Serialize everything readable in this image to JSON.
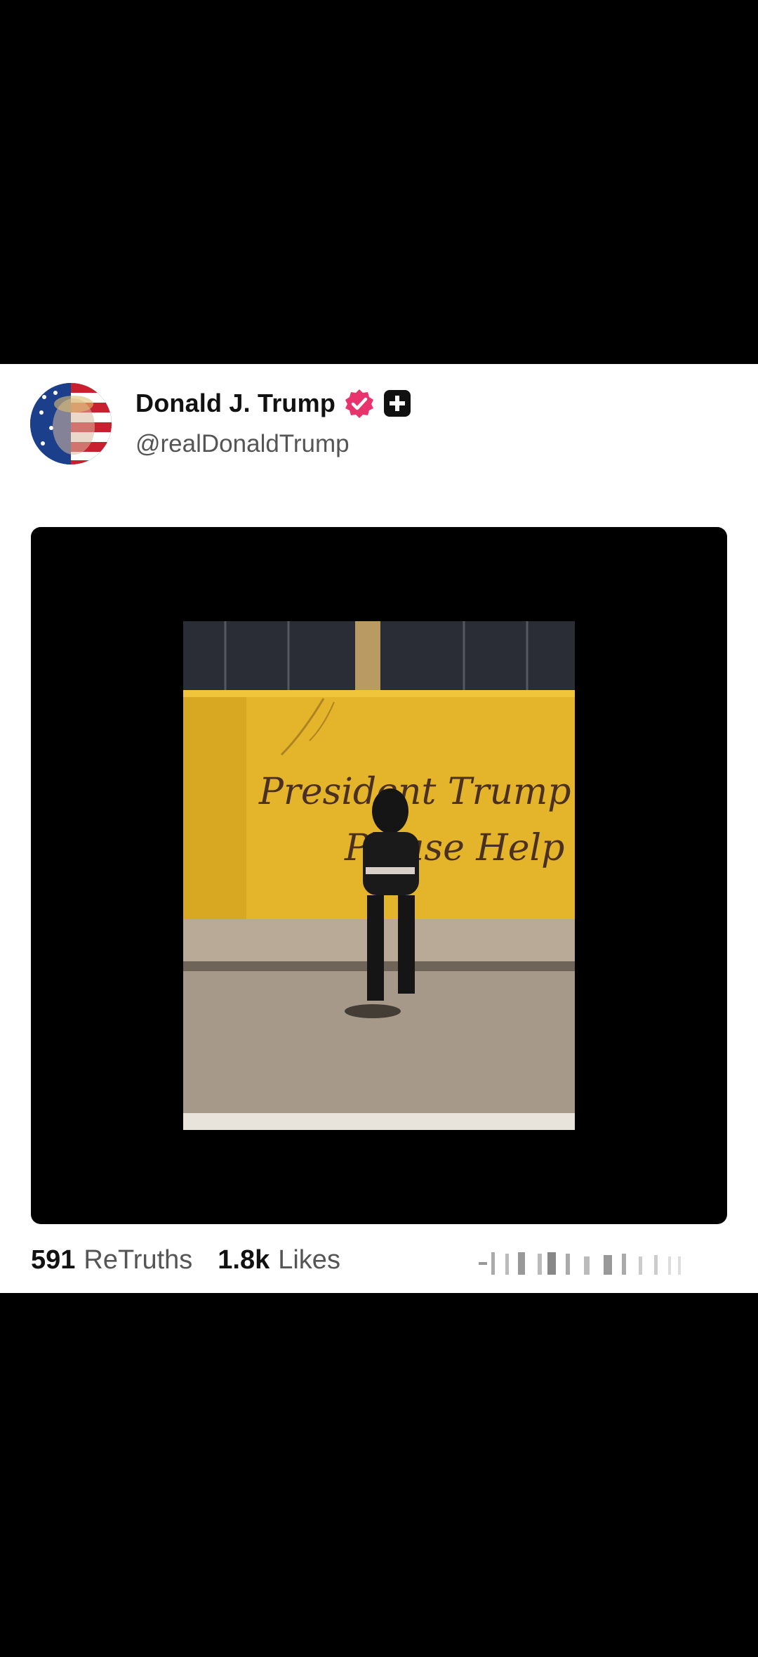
{
  "post": {
    "author": {
      "name": "Donald J. Trump",
      "handle": "@realDonaldTrump",
      "verified_icon": "verified-badge-icon",
      "platform_icon": "truth-plus-icon",
      "verified_color": "#e8336d"
    },
    "media": {
      "type": "video",
      "painted_text_line1": "President Trump",
      "painted_text_line2": "Please Help",
      "wall_color": "#e4b42a"
    },
    "stats": {
      "retruths_count": "591",
      "retruths_label": "ReTruths",
      "likes_count": "1.8k",
      "likes_label": "Likes"
    }
  }
}
